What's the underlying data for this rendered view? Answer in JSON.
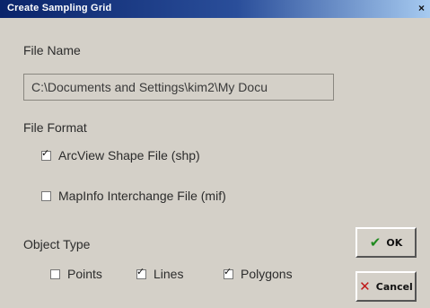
{
  "window": {
    "title": "Create Sampling Grid",
    "close_glyph": "×"
  },
  "file_name": {
    "label": "File Name",
    "value": "C:\\Documents and Settings\\kim2\\My Docu"
  },
  "file_format": {
    "label": "File Format",
    "options": [
      {
        "label": "ArcView Shape File (shp)",
        "checked": true
      },
      {
        "label": "MapInfo Interchange File (mif)",
        "checked": false
      }
    ]
  },
  "object_type": {
    "label": "Object Type",
    "options": [
      {
        "label": "Points",
        "checked": false
      },
      {
        "label": "Lines",
        "checked": true
      },
      {
        "label": "Polygons",
        "checked": true
      }
    ]
  },
  "buttons": {
    "ok": {
      "label": "OK",
      "icon": "check-icon"
    },
    "cancel": {
      "label": "Cancel",
      "icon": "x-icon"
    }
  },
  "colors": {
    "title_bar": "#0a246a",
    "dialog_bg": "#d4d0c8",
    "ok_icon": "#1f8a1f",
    "cancel_icon": "#c01818"
  }
}
